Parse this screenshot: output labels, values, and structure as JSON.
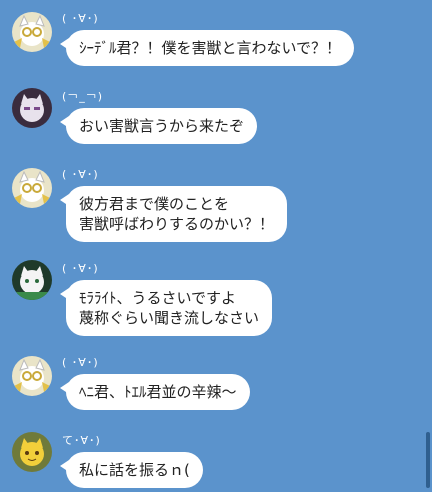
{
  "messages": [
    {
      "sender": "( ･∀･)",
      "text": "ｼｰﾃﾞﾙ君？！僕を害獣と言わないで？！",
      "avatar": "cat-glasses-icon"
    },
    {
      "sender": "(￢_￢)",
      "text": "おい害獣言うから来たぞ",
      "avatar": "dark-cat-icon"
    },
    {
      "sender": "( ･∀･)",
      "text": "彼方君まで僕のことを\n害獣呼ばわりするのかい？！",
      "avatar": "cat-glasses-icon"
    },
    {
      "sender": "( ･∀･)",
      "text": "ﾓﾗﾗｲﾄ、うるさいですよ\n蔑称ぐらい聞き流しなさい",
      "avatar": "white-cat-icon"
    },
    {
      "sender": "( ･∀･)",
      "text": "ﾍﾆ君、ﾄｴﾙ君並の辛辣～",
      "avatar": "cat-glasses-icon"
    },
    {
      "sender": "て･∀･)",
      "text": "私に話を振るｎ(",
      "avatar": "yellow-cat-icon"
    }
  ],
  "colors": {
    "background": "#5b93cc",
    "bubble": "#ffffff"
  }
}
